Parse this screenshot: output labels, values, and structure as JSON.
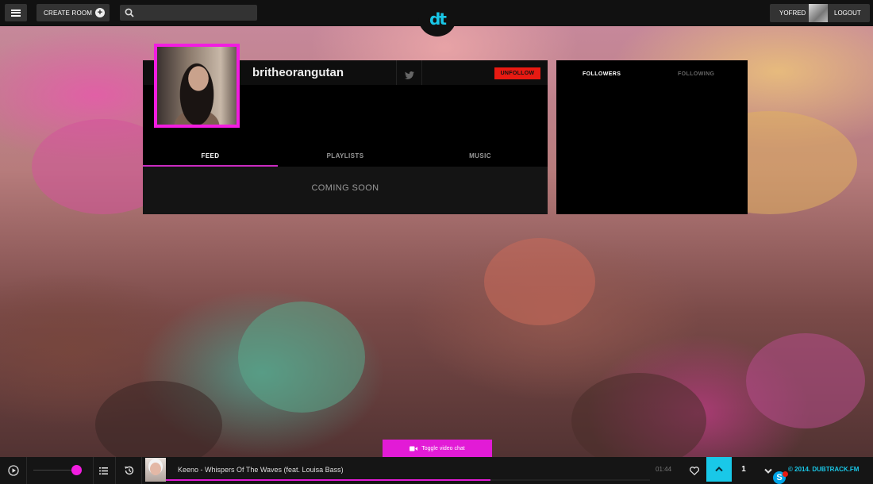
{
  "header": {
    "create_room_label": "CREATE ROOM",
    "search_placeholder": "",
    "logo_text": "dt",
    "username": "YOFRED",
    "logout_label": "LOGOUT"
  },
  "profile": {
    "username": "britheorangutan",
    "unfollow_label": "UNFOLLOW",
    "tabs": [
      {
        "label": "FEED",
        "active": true
      },
      {
        "label": "PLAYLISTS",
        "active": false
      },
      {
        "label": "MUSIC",
        "active": false
      }
    ],
    "feed_message": "COMING SOON"
  },
  "follow_panel": {
    "tabs": [
      {
        "label": "FOLLOWERS",
        "active": true
      },
      {
        "label": "FOLLOWING",
        "active": false
      }
    ]
  },
  "video_chat": {
    "label": "Toggle video chat"
  },
  "player": {
    "song_title": "Keeno - Whispers Of The Waves (feat. Louisa Bass)",
    "time": "01:44",
    "progress": 0.67,
    "volume": 0.9,
    "vote_count": "1",
    "copyright": "© 2014. DUBTRACK.FM"
  },
  "colors": {
    "accent_pink": "#e21bd6",
    "accent_cyan": "#19c8e8",
    "unfollow_red": "#e81a12"
  },
  "icons": {
    "menu": "hamburger-icon",
    "create": "plus-circle-icon",
    "search": "search-icon",
    "twitter": "twitter-icon",
    "play": "play-icon",
    "queue": "list-icon",
    "history": "history-icon",
    "heart": "heart-icon",
    "upvote": "chevron-up-icon",
    "downvote": "chevron-down-icon",
    "video": "video-camera-icon",
    "skype": "skype-icon"
  }
}
